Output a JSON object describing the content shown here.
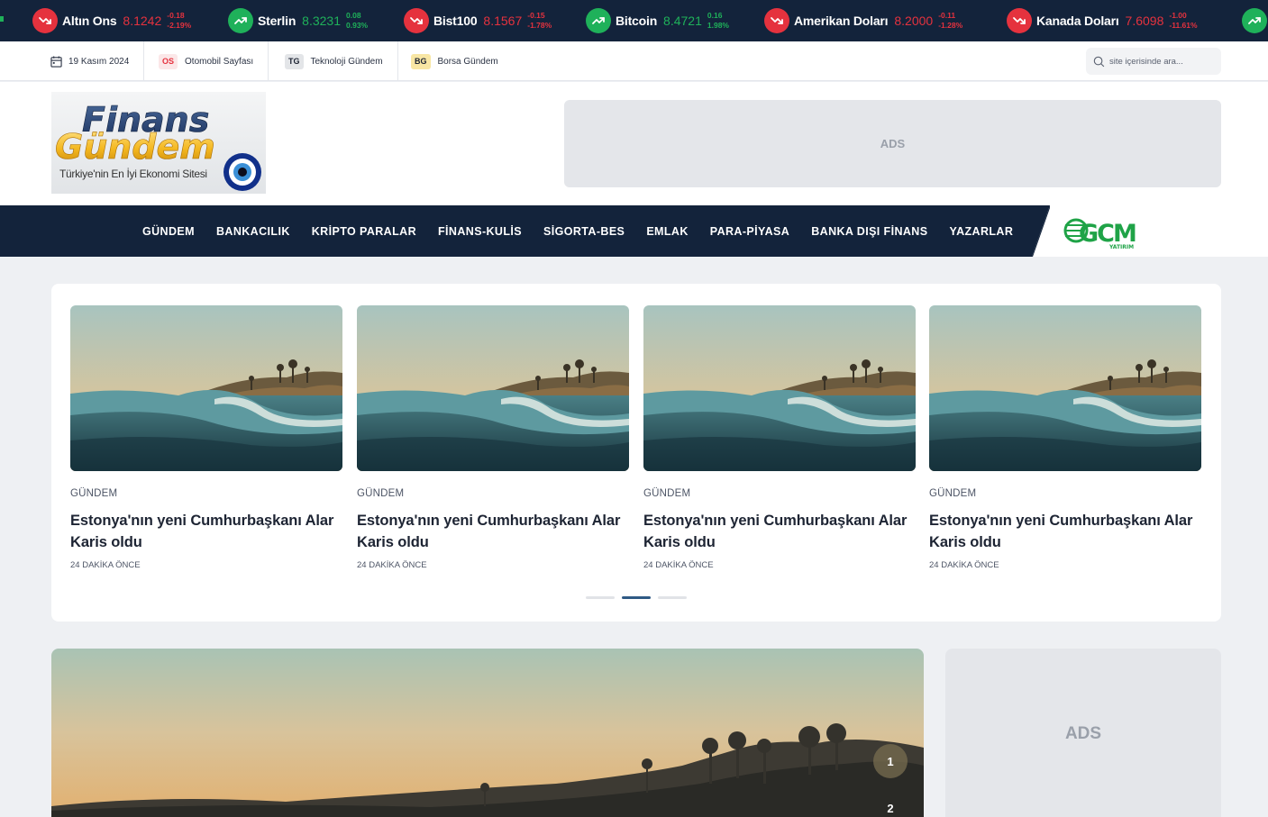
{
  "ticker": [
    {
      "name": "Altın Ons",
      "value": "8.1242",
      "change": "-0.18",
      "percent": "-2.19%",
      "trend": "down",
      "icon": "trend-down-icon"
    },
    {
      "name": "Sterlin",
      "value": "8.3231",
      "change": "0.08",
      "percent": "0.93%",
      "trend": "up",
      "icon": "trend-up-icon"
    },
    {
      "name": "Bist100",
      "value": "8.1567",
      "change": "-0.15",
      "percent": "-1.78%",
      "trend": "down",
      "icon": "trend-down-icon"
    },
    {
      "name": "Bitcoin",
      "value": "8.4721",
      "change": "0.16",
      "percent": "1.98%",
      "trend": "up",
      "icon": "trend-up-icon"
    },
    {
      "name": "Amerikan Doları",
      "value": "8.2000",
      "change": "-0.11",
      "percent": "-1.28%",
      "trend": "down",
      "icon": "trend-down-icon"
    },
    {
      "name": "Kanada Doları",
      "value": "7.6098",
      "change": "-1.00",
      "percent": "-11.61%",
      "trend": "down",
      "icon": "trend-down-icon"
    }
  ],
  "subbar": {
    "date": "19 Kasım 2024",
    "links": [
      {
        "badge": "OS",
        "label": "Otomobil Sayfası",
        "color": "#e5323e",
        "bg": "#fbe7e8"
      },
      {
        "badge": "TG",
        "label": "Teknoloji Gündem",
        "color": "#1d2433",
        "bg": "#e3e5e8"
      },
      {
        "badge": "BG",
        "label": "Borsa Gündem",
        "color": "#1d2433",
        "bg": "#f8e6a4"
      }
    ],
    "search_placeholder": "site içerisinde ara..."
  },
  "header": {
    "logo_line1": "Finans",
    "logo_line2": "Gündem",
    "logo_tagline": "Türkiye'nin En İyi Ekonomi Sitesi",
    "ads_label": "ADS"
  },
  "nav": {
    "items": [
      "GÜNDEM",
      "BANKACILIK",
      "KRİPTO PARALAR",
      "FİNANS-KULİS",
      "SİGORTA-BES",
      "EMLAK",
      "PARA-PİYASA",
      "BANKA DIŞI FİNANS",
      "YAZARLAR"
    ],
    "partner_logo": "GCM",
    "partner_sub": "YATIRIM"
  },
  "slider": {
    "cards": [
      {
        "category": "GÜNDEM",
        "title": "Estonya'nın yeni Cumhurbaşkanı Alar Karis oldu",
        "time": "24 DAKİKA ÖNCE"
      },
      {
        "category": "GÜNDEM",
        "title": "Estonya'nın yeni Cumhurbaşkanı Alar Karis oldu",
        "time": "24 DAKİKA ÖNCE"
      },
      {
        "category": "GÜNDEM",
        "title": "Estonya'nın yeni Cumhurbaşkanı Alar Karis oldu",
        "time": "24 DAKİKA ÖNCE"
      },
      {
        "category": "GÜNDEM",
        "title": "Estonya'nın yeni Cumhurbaşkanı Alar Karis oldu",
        "time": "24 DAKİKA ÖNCE"
      }
    ],
    "active_dot": 1
  },
  "feature": {
    "pager": [
      "1",
      "2"
    ]
  },
  "side_ads_label": "ADS",
  "colors": {
    "navy": "#13233b",
    "down": "#e5323e",
    "up": "#1fb15a",
    "accent": "#2f5a85"
  }
}
